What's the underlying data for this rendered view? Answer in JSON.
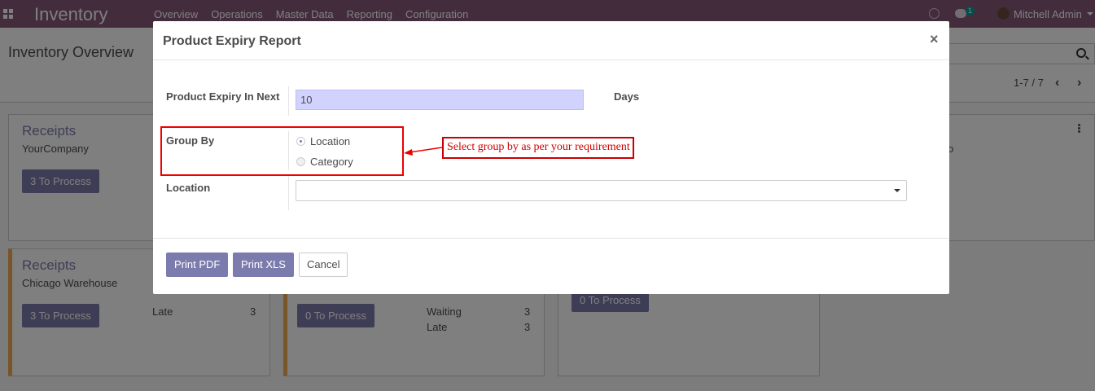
{
  "navbar": {
    "app_name": "Inventory",
    "menu": [
      "Overview",
      "Operations",
      "Master Data",
      "Reporting",
      "Configuration"
    ],
    "chat_badge": "1",
    "username": "Mitchell Admin"
  },
  "control_panel": {
    "title": "Inventory Overview",
    "pager": "1-7 / 7"
  },
  "cards": [
    {
      "title": "Receipts",
      "subtitle": "YourCompany",
      "button": "3 To Process"
    },
    {
      "title": "Receipts",
      "subtitle": "Chicago Warehouse",
      "button": "3 To Process",
      "stats": [
        {
          "label": "Late",
          "value": "3"
        }
      ]
    },
    {
      "button": "0 To Process",
      "stats": [
        {
          "label": "Waiting",
          "value": "3"
        },
        {
          "label": "Late",
          "value": "3"
        }
      ]
    },
    {
      "button": "0 To Process"
    }
  ],
  "partial_text": {
    "right_card": "o"
  },
  "modal": {
    "title": "Product Expiry Report",
    "close": "×",
    "fields": {
      "expiry_label": "Product Expiry In Next",
      "expiry_value": "10",
      "days_label": "Days",
      "group_by_label": "Group By",
      "group_options": [
        {
          "label": "Location",
          "checked": true
        },
        {
          "label": "Category",
          "checked": false
        }
      ],
      "location_label": "Location",
      "location_value": ""
    },
    "buttons": {
      "print_pdf": "Print PDF",
      "print_xls": "Print XLS",
      "cancel": "Cancel"
    }
  },
  "annotation": {
    "note": "Select group by as per your requirement",
    "color": "#cc0000"
  },
  "colors": {
    "navbar": "#875a7b",
    "primary": "#7c7bad",
    "input_highlight": "#d2d2ff",
    "card_accent": "#f0ad4e"
  }
}
